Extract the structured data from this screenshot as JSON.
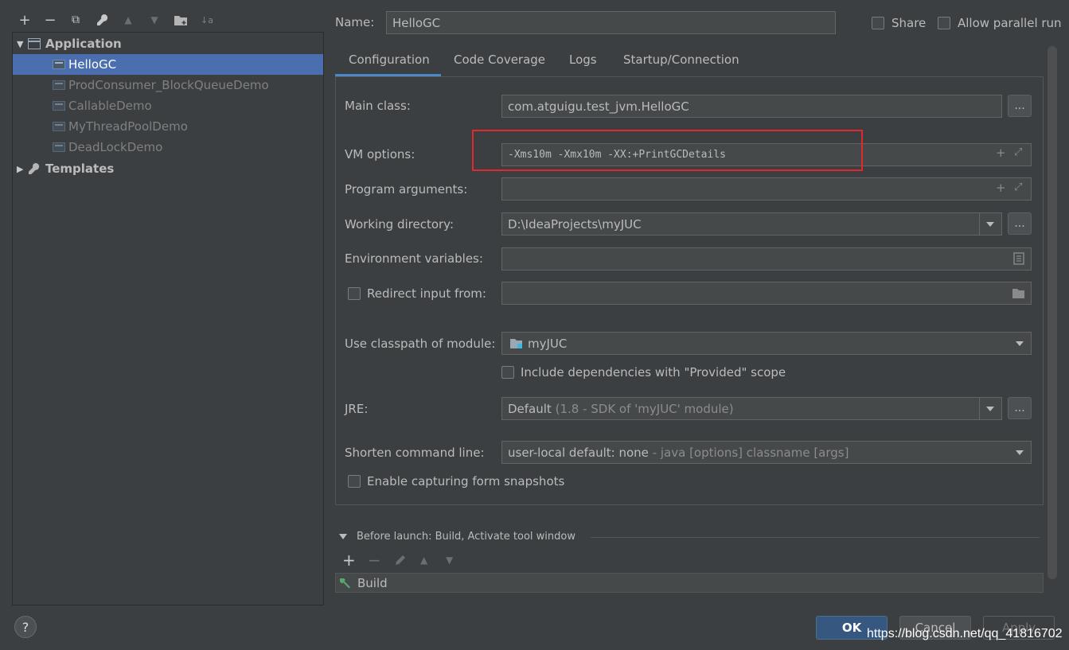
{
  "toolbar": {
    "add": "+",
    "remove": "−",
    "copy": "⧉",
    "edit": "🔧",
    "up": "▲",
    "down": "▼",
    "folder": "📁",
    "sort": "↓a"
  },
  "tree": {
    "application_label": "Application",
    "items": [
      "HelloGC",
      "ProdConsumer_BlockQueueDemo",
      "CallableDemo",
      "MyThreadPoolDemo",
      "DeadLockDemo"
    ],
    "templates_label": "Templates"
  },
  "header": {
    "name_label": "Name:",
    "name_value": "HelloGC",
    "share_label": "Share",
    "parallel_label": "Allow parallel run"
  },
  "tabs": [
    "Configuration",
    "Code Coverage",
    "Logs",
    "Startup/Connection"
  ],
  "form": {
    "main_class_label": "Main class:",
    "main_class_value": "com.atguigu.test_jvm.HelloGC",
    "vm_options_label": "VM options:",
    "vm_options_value": "-Xms10m -Xmx10m -XX:+PrintGCDetails",
    "program_args_label": "Program arguments:",
    "working_dir_label": "Working directory:",
    "working_dir_value": "D:\\IdeaProjects\\myJUC",
    "env_vars_label": "Environment variables:",
    "redirect_label": "Redirect input from:",
    "classpath_label": "Use classpath of module:",
    "classpath_value": "myJUC",
    "include_deps_label": "Include dependencies with \"Provided\" scope",
    "jre_label": "JRE:",
    "jre_value_main": "Default",
    "jre_value_sub": "(1.8 - SDK of 'myJUC' module)",
    "shorten_label": "Shorten command line:",
    "shorten_value_main": "user-local default: none",
    "shorten_value_sub": " - java [options] classname [args]",
    "snapshots_label": "Enable capturing form snapshots",
    "dots": "..."
  },
  "before_launch": {
    "title": "Before launch: Build, Activate tool window",
    "item": "Build"
  },
  "footer": {
    "help": "?",
    "ok": "OK",
    "cancel": "Cancel",
    "apply": "Apply",
    "watermark": "https://blog.csdn.net/qq_41816702"
  },
  "colors": {
    "background": "#3c3f41",
    "selection": "#4b6eaf",
    "highlight_box": "#e0282e",
    "primary_button": "#365880"
  }
}
